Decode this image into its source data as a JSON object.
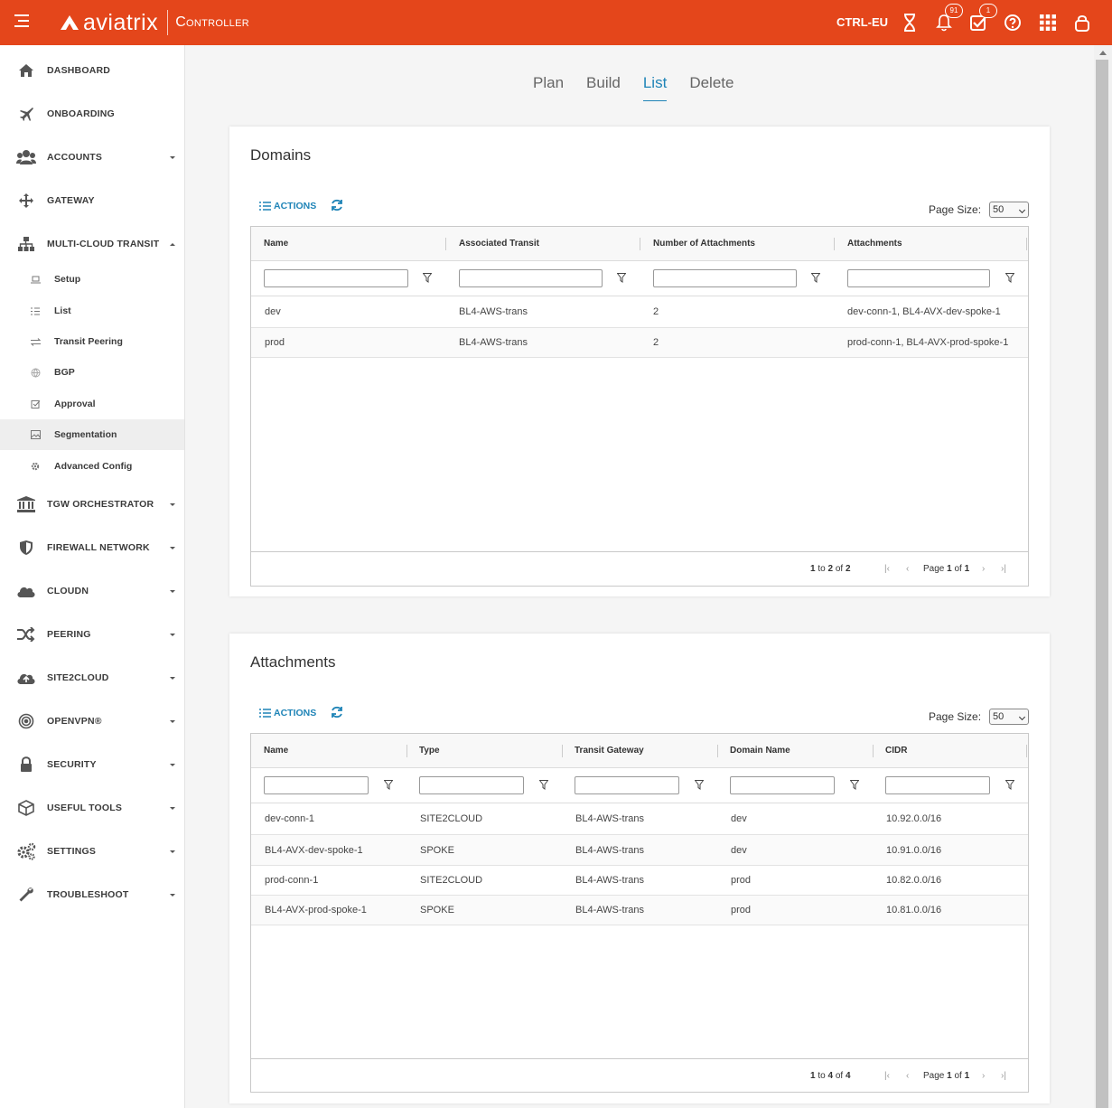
{
  "header": {
    "brand": "aviatrix",
    "product": "Controller",
    "controller_name": "CTRL-EU",
    "notifications_badge": "91",
    "tasks_badge": "1",
    "accent_color": "#e4461b"
  },
  "sidebar": {
    "items": [
      {
        "label": "DASHBOARD",
        "icon": "home-icon"
      },
      {
        "label": "ONBOARDING",
        "icon": "plane-icon"
      },
      {
        "label": "ACCOUNTS",
        "icon": "users-icon"
      },
      {
        "label": "GATEWAY",
        "icon": "arrows-icon"
      },
      {
        "label": "MULTI-CLOUD TRANSIT",
        "icon": "network-icon"
      },
      {
        "label": "TGW ORCHESTRATOR",
        "icon": "bank-icon"
      },
      {
        "label": "FIREWALL NETWORK",
        "icon": "shield-icon"
      },
      {
        "label": "CLOUDN",
        "icon": "cloud-icon"
      },
      {
        "label": "PEERING",
        "icon": "shuffle-icon"
      },
      {
        "label": "SITE2CLOUD",
        "icon": "cloud-upload-icon"
      },
      {
        "label": "OPENVPN®",
        "icon": "target-icon"
      },
      {
        "label": "SECURITY",
        "icon": "lock-icon"
      },
      {
        "label": "USEFUL TOOLS",
        "icon": "cube-icon"
      },
      {
        "label": "SETTINGS",
        "icon": "gears-icon"
      },
      {
        "label": "TROUBLESHOOT",
        "icon": "wrench-icon"
      }
    ],
    "sub_items": [
      {
        "label": "Setup",
        "icon": "laptop-icon"
      },
      {
        "label": "List",
        "icon": "list-icon"
      },
      {
        "label": "Transit Peering",
        "icon": "exchange-icon"
      },
      {
        "label": "BGP",
        "icon": "globe-icon"
      },
      {
        "label": "Approval",
        "icon": "check-square-icon"
      },
      {
        "label": "Segmentation",
        "icon": "image-icon"
      },
      {
        "label": "Advanced Config",
        "icon": "gear-icon"
      }
    ]
  },
  "tabs": [
    "Plan",
    "Build",
    "List",
    "Delete"
  ],
  "active_tab": "List",
  "domains": {
    "title": "Domains",
    "actions_label": "ACTIONS",
    "page_size_label": "Page Size:",
    "page_size": "50",
    "columns": [
      "Name",
      "Associated Transit",
      "Number of Attachments",
      "Attachments"
    ],
    "rows": [
      [
        "dev",
        "BL4-AWS-trans",
        "2",
        "dev-conn-1, BL4-AVX-dev-spoke-1"
      ],
      [
        "prod",
        "BL4-AWS-trans",
        "2",
        "prod-conn-1, BL4-AVX-prod-spoke-1"
      ]
    ],
    "footer": {
      "from": "1",
      "to_word": "to",
      "to": "2",
      "of_word": "of",
      "total": "2",
      "page_word": "Page",
      "page": "1",
      "pages": "1"
    }
  },
  "attachments": {
    "title": "Attachments",
    "actions_label": "ACTIONS",
    "page_size_label": "Page Size:",
    "page_size": "50",
    "columns": [
      "Name",
      "Type",
      "Transit Gateway",
      "Domain Name",
      "CIDR"
    ],
    "rows": [
      [
        "dev-conn-1",
        "SITE2CLOUD",
        "BL4-AWS-trans",
        "dev",
        "10.92.0.0/16"
      ],
      [
        "BL4-AVX-dev-spoke-1",
        "SPOKE",
        "BL4-AWS-trans",
        "dev",
        "10.91.0.0/16"
      ],
      [
        "prod-conn-1",
        "SITE2CLOUD",
        "BL4-AWS-trans",
        "prod",
        "10.82.0.0/16"
      ],
      [
        "BL4-AVX-prod-spoke-1",
        "SPOKE",
        "BL4-AWS-trans",
        "prod",
        "10.81.0.0/16"
      ]
    ],
    "footer": {
      "from": "1",
      "to_word": "to",
      "to": "4",
      "of_word": "of",
      "total": "4",
      "page_word": "Page",
      "page": "1",
      "pages": "1"
    }
  }
}
